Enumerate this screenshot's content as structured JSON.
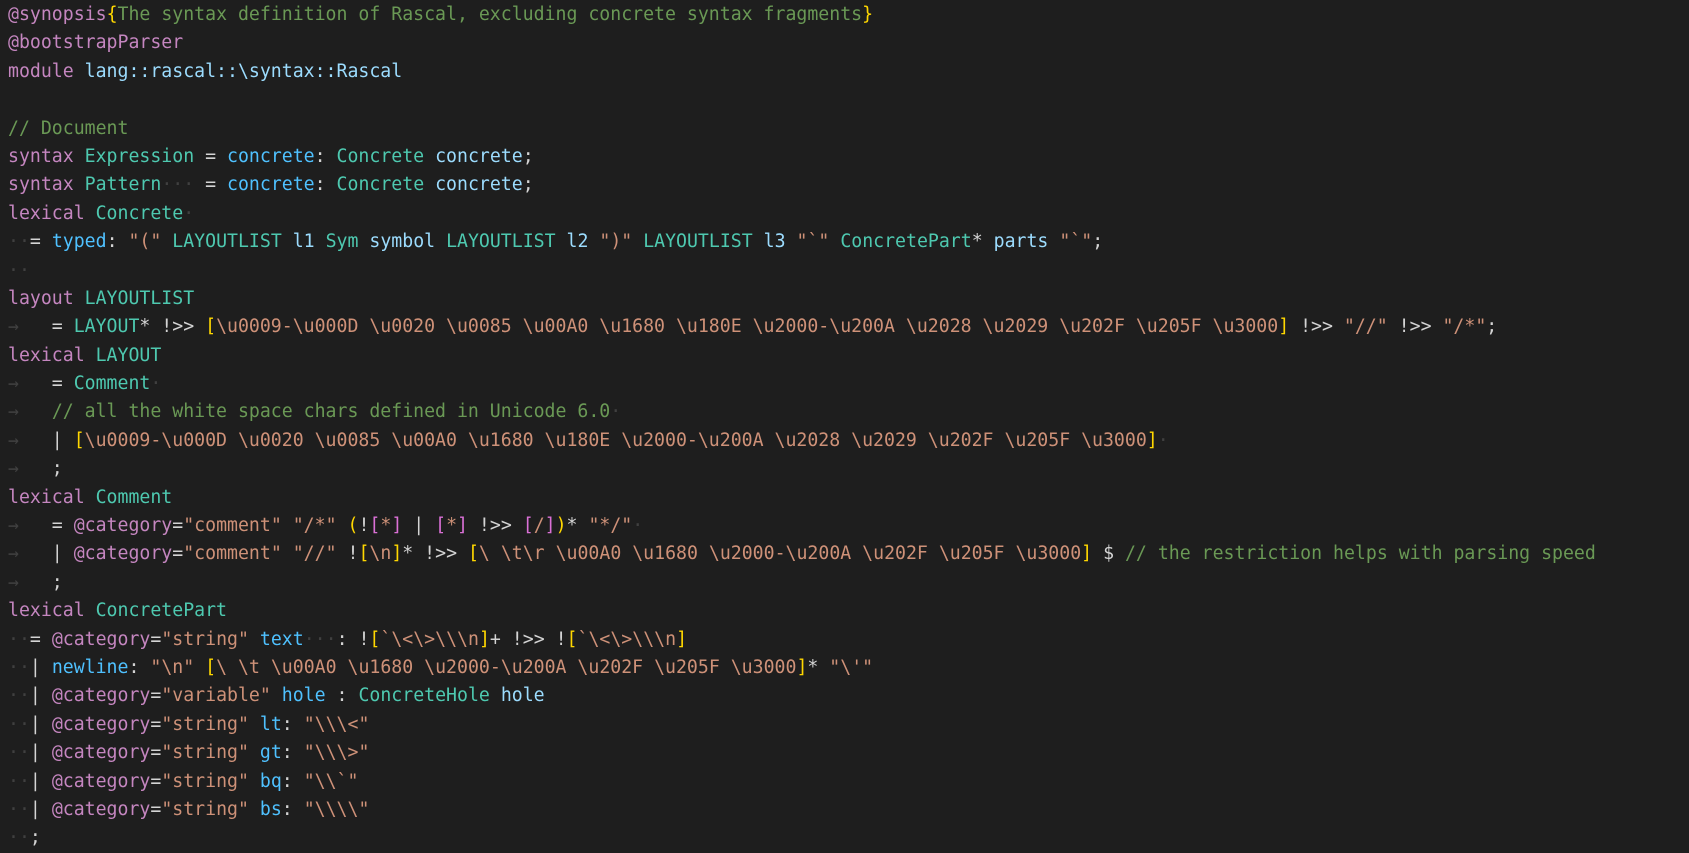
{
  "colors": {
    "background": "#1e1e1e",
    "keyword": "#c586c0",
    "type": "#4ec9b0",
    "variable": "#9cdcfe",
    "label": "#4fc1ff",
    "string": "#ce9178",
    "comment": "#6a9955",
    "bracket_gold": "#ffd700",
    "bracket_pink": "#da70d6",
    "whitespace": "#404040"
  },
  "lines": [
    [
      [
        "ann",
        "@synopsis"
      ],
      [
        "br",
        "{"
      ],
      [
        "com",
        "The syntax definition of Rascal, excluding concrete syntax fragments"
      ],
      [
        "br",
        "}"
      ]
    ],
    [
      [
        "ann",
        "@bootstrapParser"
      ]
    ],
    [
      [
        "kw",
        "module"
      ],
      [
        "plain",
        " "
      ],
      [
        "var",
        "lang::rascal::\\syntax::Rascal"
      ]
    ],
    [],
    [
      [
        "com",
        "// Document"
      ]
    ],
    [
      [
        "kw",
        "syntax"
      ],
      [
        "plain",
        " "
      ],
      [
        "ty",
        "Expression"
      ],
      [
        "plain",
        " = "
      ],
      [
        "lbl",
        "concrete"
      ],
      [
        "plain",
        ": "
      ],
      [
        "ty",
        "Concrete"
      ],
      [
        "plain",
        " "
      ],
      [
        "var",
        "concrete"
      ],
      [
        "plain",
        ";"
      ]
    ],
    [
      [
        "kw",
        "syntax"
      ],
      [
        "plain",
        " "
      ],
      [
        "ty",
        "Pattern"
      ],
      [
        "ws",
        "···"
      ],
      [
        "plain",
        " = "
      ],
      [
        "lbl",
        "concrete"
      ],
      [
        "plain",
        ": "
      ],
      [
        "ty",
        "Concrete"
      ],
      [
        "plain",
        " "
      ],
      [
        "var",
        "concrete"
      ],
      [
        "plain",
        ";"
      ]
    ],
    [
      [
        "kw",
        "lexical"
      ],
      [
        "plain",
        " "
      ],
      [
        "ty",
        "Concrete"
      ],
      [
        "ws",
        "·"
      ]
    ],
    [
      [
        "ws",
        "··"
      ],
      [
        "plain",
        "= "
      ],
      [
        "lbl",
        "typed"
      ],
      [
        "plain",
        ": "
      ],
      [
        "str",
        "\"(\""
      ],
      [
        "plain",
        " "
      ],
      [
        "ty",
        "LAYOUTLIST"
      ],
      [
        "plain",
        " "
      ],
      [
        "var",
        "l1"
      ],
      [
        "plain",
        " "
      ],
      [
        "ty",
        "Sym"
      ],
      [
        "plain",
        " "
      ],
      [
        "var",
        "symbol"
      ],
      [
        "plain",
        " "
      ],
      [
        "ty",
        "LAYOUTLIST"
      ],
      [
        "plain",
        " "
      ],
      [
        "var",
        "l2"
      ],
      [
        "plain",
        " "
      ],
      [
        "str",
        "\")\""
      ],
      [
        "plain",
        " "
      ],
      [
        "ty",
        "LAYOUTLIST"
      ],
      [
        "plain",
        " "
      ],
      [
        "var",
        "l3"
      ],
      [
        "plain",
        " "
      ],
      [
        "str",
        "\"`\""
      ],
      [
        "plain",
        " "
      ],
      [
        "ty",
        "ConcretePart"
      ],
      [
        "plain",
        "* "
      ],
      [
        "var",
        "parts"
      ],
      [
        "plain",
        " "
      ],
      [
        "str",
        "\"`\""
      ],
      [
        "plain",
        ";"
      ]
    ],
    [
      [
        "ws",
        "··"
      ]
    ],
    [
      [
        "kw",
        "layout"
      ],
      [
        "plain",
        " "
      ],
      [
        "ty",
        "LAYOUTLIST"
      ]
    ],
    [
      [
        "ws",
        "→"
      ],
      [
        "plain",
        "   = "
      ],
      [
        "ty",
        "LAYOUT"
      ],
      [
        "plain",
        "* !>> "
      ],
      [
        "br",
        "["
      ],
      [
        "str",
        "\\u0009-\\u000D \\u0020 \\u0085 \\u00A0 \\u1680 \\u180E \\u2000-\\u200A \\u2028 \\u2029 \\u202F \\u205F \\u3000"
      ],
      [
        "br",
        "]"
      ],
      [
        "plain",
        " !>> "
      ],
      [
        "str",
        "\"//\""
      ],
      [
        "plain",
        " !>> "
      ],
      [
        "str",
        "\"/*\""
      ],
      [
        "plain",
        ";"
      ]
    ],
    [
      [
        "kw",
        "lexical"
      ],
      [
        "plain",
        " "
      ],
      [
        "ty",
        "LAYOUT"
      ]
    ],
    [
      [
        "ws",
        "→"
      ],
      [
        "plain",
        "   = "
      ],
      [
        "ty",
        "Comment"
      ],
      [
        "ws",
        "·"
      ]
    ],
    [
      [
        "ws",
        "→"
      ],
      [
        "plain",
        "   "
      ],
      [
        "com",
        "// all the white space chars defined in Unicode 6.0"
      ],
      [
        "ws",
        "·"
      ]
    ],
    [
      [
        "ws",
        "→"
      ],
      [
        "plain",
        "   | "
      ],
      [
        "br",
        "["
      ],
      [
        "str",
        "\\u0009-\\u000D \\u0020 \\u0085 \\u00A0 \\u1680 \\u180E \\u2000-\\u200A \\u2028 \\u2029 \\u202F \\u205F \\u3000"
      ],
      [
        "br",
        "]"
      ],
      [
        "ws",
        "·"
      ]
    ],
    [
      [
        "ws",
        "→"
      ],
      [
        "plain",
        "   ;"
      ]
    ],
    [
      [
        "kw",
        "lexical"
      ],
      [
        "plain",
        " "
      ],
      [
        "ty",
        "Comment"
      ]
    ],
    [
      [
        "ws",
        "→"
      ],
      [
        "plain",
        "   = "
      ],
      [
        "ann",
        "@category"
      ],
      [
        "plain",
        "="
      ],
      [
        "str",
        "\"comment\""
      ],
      [
        "plain",
        " "
      ],
      [
        "str",
        "\"/*\""
      ],
      [
        "plain",
        " "
      ],
      [
        "br",
        "("
      ],
      [
        "plain",
        "!"
      ],
      [
        "br2",
        "["
      ],
      [
        "str",
        "*"
      ],
      [
        "br2",
        "]"
      ],
      [
        "plain",
        " | "
      ],
      [
        "br2",
        "["
      ],
      [
        "str",
        "*"
      ],
      [
        "br2",
        "]"
      ],
      [
        "plain",
        " !>> "
      ],
      [
        "br2",
        "["
      ],
      [
        "str",
        "/"
      ],
      [
        "br2",
        "]"
      ],
      [
        "br",
        ")"
      ],
      [
        "plain",
        "* "
      ],
      [
        "str",
        "\"*/\""
      ],
      [
        "ws",
        "·"
      ]
    ],
    [
      [
        "ws",
        "→"
      ],
      [
        "plain",
        "   | "
      ],
      [
        "ann",
        "@category"
      ],
      [
        "plain",
        "="
      ],
      [
        "str",
        "\"comment\""
      ],
      [
        "plain",
        " "
      ],
      [
        "str",
        "\"//\""
      ],
      [
        "plain",
        " !"
      ],
      [
        "br",
        "["
      ],
      [
        "str",
        "\\n"
      ],
      [
        "br",
        "]"
      ],
      [
        "plain",
        "* !>> "
      ],
      [
        "br",
        "["
      ],
      [
        "str",
        "\\ \\t\\r \\u00A0 \\u1680 \\u2000-\\u200A \\u202F \\u205F \\u3000"
      ],
      [
        "br",
        "]"
      ],
      [
        "plain",
        " $ "
      ],
      [
        "com",
        "// the restriction helps with parsing speed"
      ]
    ],
    [
      [
        "ws",
        "→"
      ],
      [
        "plain",
        "   ;"
      ]
    ],
    [
      [
        "kw",
        "lexical"
      ],
      [
        "plain",
        " "
      ],
      [
        "ty",
        "ConcretePart"
      ]
    ],
    [
      [
        "ws",
        "··"
      ],
      [
        "plain",
        "= "
      ],
      [
        "ann",
        "@category"
      ],
      [
        "plain",
        "="
      ],
      [
        "str",
        "\"string\""
      ],
      [
        "plain",
        " "
      ],
      [
        "lbl",
        "text"
      ],
      [
        "ws",
        "···"
      ],
      [
        "plain",
        ": !"
      ],
      [
        "br",
        "["
      ],
      [
        "str",
        "`\\<\\>\\\\\\n"
      ],
      [
        "br",
        "]"
      ],
      [
        "plain",
        "+ !>> !"
      ],
      [
        "br",
        "["
      ],
      [
        "str",
        "`\\<\\>\\\\\\n"
      ],
      [
        "br",
        "]"
      ]
    ],
    [
      [
        "ws",
        "··"
      ],
      [
        "plain",
        "| "
      ],
      [
        "lbl",
        "newline"
      ],
      [
        "plain",
        ": "
      ],
      [
        "str",
        "\"\\n\""
      ],
      [
        "plain",
        " "
      ],
      [
        "br",
        "["
      ],
      [
        "str",
        "\\ \\t \\u00A0 \\u1680 \\u2000-\\u200A \\u202F \\u205F \\u3000"
      ],
      [
        "br",
        "]"
      ],
      [
        "plain",
        "* "
      ],
      [
        "str",
        "\"\\'\""
      ]
    ],
    [
      [
        "ws",
        "··"
      ],
      [
        "plain",
        "| "
      ],
      [
        "ann",
        "@category"
      ],
      [
        "plain",
        "="
      ],
      [
        "str",
        "\"variable\""
      ],
      [
        "plain",
        " "
      ],
      [
        "lbl",
        "hole"
      ],
      [
        "plain",
        " : "
      ],
      [
        "ty",
        "ConcreteHole"
      ],
      [
        "plain",
        " "
      ],
      [
        "var",
        "hole"
      ]
    ],
    [
      [
        "ws",
        "··"
      ],
      [
        "plain",
        "| "
      ],
      [
        "ann",
        "@category"
      ],
      [
        "plain",
        "="
      ],
      [
        "str",
        "\"string\""
      ],
      [
        "plain",
        " "
      ],
      [
        "lbl",
        "lt"
      ],
      [
        "plain",
        ": "
      ],
      [
        "str",
        "\"\\\\\\<\""
      ]
    ],
    [
      [
        "ws",
        "··"
      ],
      [
        "plain",
        "| "
      ],
      [
        "ann",
        "@category"
      ],
      [
        "plain",
        "="
      ],
      [
        "str",
        "\"string\""
      ],
      [
        "plain",
        " "
      ],
      [
        "lbl",
        "gt"
      ],
      [
        "plain",
        ": "
      ],
      [
        "str",
        "\"\\\\\\>\""
      ]
    ],
    [
      [
        "ws",
        "··"
      ],
      [
        "plain",
        "| "
      ],
      [
        "ann",
        "@category"
      ],
      [
        "plain",
        "="
      ],
      [
        "str",
        "\"string\""
      ],
      [
        "plain",
        " "
      ],
      [
        "lbl",
        "bq"
      ],
      [
        "plain",
        ": "
      ],
      [
        "str",
        "\"\\\\`\""
      ]
    ],
    [
      [
        "ws",
        "··"
      ],
      [
        "plain",
        "| "
      ],
      [
        "ann",
        "@category"
      ],
      [
        "plain",
        "="
      ],
      [
        "str",
        "\"string\""
      ],
      [
        "plain",
        " "
      ],
      [
        "lbl",
        "bs"
      ],
      [
        "plain",
        ": "
      ],
      [
        "str",
        "\"\\\\\\\\\""
      ]
    ],
    [
      [
        "ws",
        "··"
      ],
      [
        "plain",
        ";"
      ]
    ]
  ]
}
